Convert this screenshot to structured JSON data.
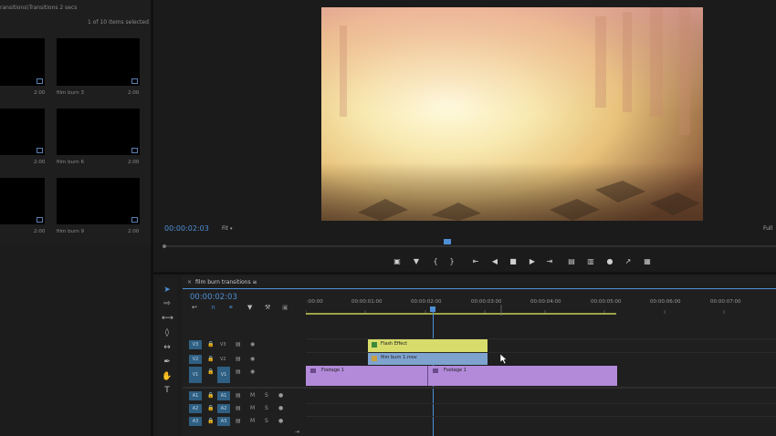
{
  "project": {
    "path": "ransitions\\Transitions 2 secs",
    "item_count": "1 of 10 items selected",
    "items": [
      {
        "name": "",
        "duration": "2:00"
      },
      {
        "name": "film burn 3",
        "duration": "2:00"
      },
      {
        "name": "",
        "duration": "2:00"
      },
      {
        "name": "film burn 6",
        "duration": "2:00"
      },
      {
        "name": "",
        "duration": "2:00"
      },
      {
        "name": "film burn 9",
        "duration": "2:00"
      }
    ]
  },
  "monitor": {
    "timecode": "00:00:02:03",
    "fit": "Fit",
    "resolution": "Full",
    "controls": [
      "marker-icon",
      "mark-in-icon",
      "mark-out-icon",
      "go-to-in-icon",
      "step-back-icon",
      "stop-icon",
      "step-forward-icon",
      "go-to-out-icon",
      "lift-icon",
      "extract-icon",
      "export-frame-icon",
      "insert-icon",
      "overwrite-icon"
    ]
  },
  "timeline": {
    "sequence_name": "film burn transitions",
    "timecode": "00:00:02:03",
    "ruler": [
      ":00:00",
      "00:00:01:00",
      "00:00:02:00",
      "00:00:03:00",
      "00:00:04:00",
      "00:00:05:00",
      "00:00:06:00",
      "00:00:07:00"
    ],
    "video_tracks": [
      {
        "target": "V3",
        "name": "V3"
      },
      {
        "target": "V2",
        "name": "V2"
      },
      {
        "target": "V1",
        "name": "V1"
      }
    ],
    "audio_tracks": [
      {
        "target": "A1",
        "name": "A1"
      },
      {
        "target": "A2",
        "name": "A2"
      },
      {
        "target": "A3",
        "name": "A3"
      }
    ],
    "clips": {
      "flash": "Flash Effect",
      "filmburn": "film burn 1.mov",
      "footage_a": "Footage 1",
      "footage_b": "Footage 1"
    },
    "colors": {
      "flash": "#d7dc6a",
      "filmburn": "#7ea3cf",
      "footage": "#b28ad9"
    }
  }
}
